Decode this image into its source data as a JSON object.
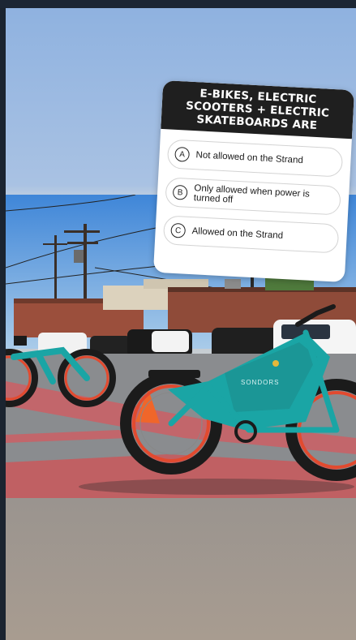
{
  "quiz": {
    "question": "E-BIKES, ELECTRIC SCOOTERS + ELECTRIC SKATEBOARDS ARE",
    "options": [
      {
        "letter": "A",
        "text": "Not allowed on the Strand"
      },
      {
        "letter": "B",
        "text": "Only allowed when power is turned off"
      },
      {
        "letter": "C",
        "text": "Allowed on the Strand"
      }
    ]
  },
  "photo": {
    "bike_brand": "SONDORS",
    "bike_color": "#1aa5a5",
    "rim_color": "#e24a2f"
  }
}
